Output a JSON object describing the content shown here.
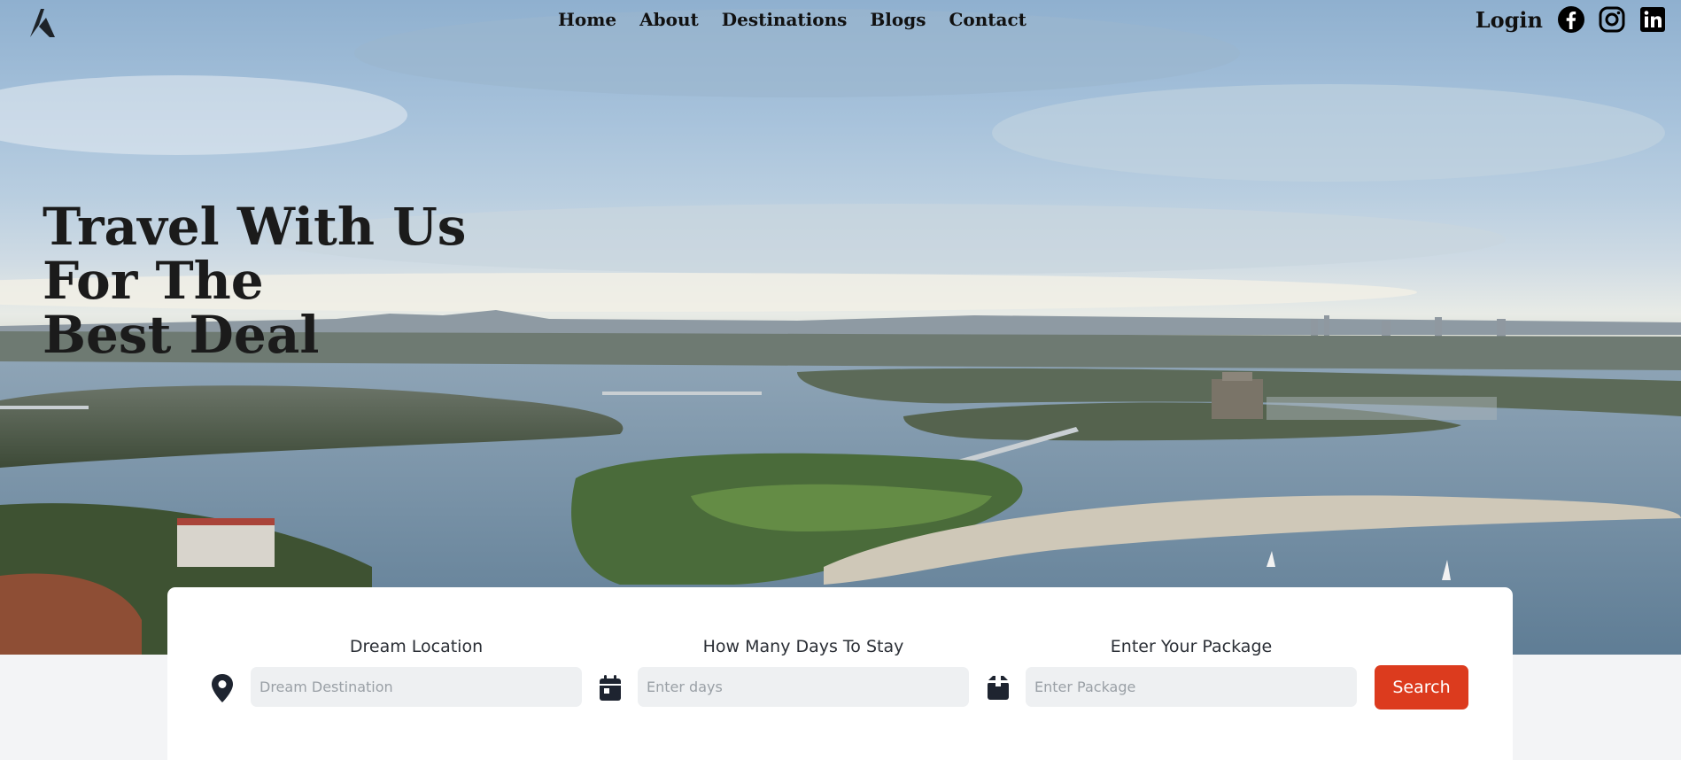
{
  "nav": {
    "links": [
      "Home",
      "About",
      "Destinations",
      "Blogs",
      "Contact"
    ],
    "login": "Login"
  },
  "icons": {
    "logo": "a-logo-icon",
    "facebook": "facebook-icon",
    "instagram": "instagram-icon",
    "linkedin": "linkedin-icon",
    "location": "map-pin-icon",
    "days": "calendar-icon",
    "package": "box-icon"
  },
  "hero": {
    "headline": [
      "Travel With Us",
      "For The",
      "Best Deal"
    ]
  },
  "search": {
    "location": {
      "label": "Dream Location",
      "placeholder": "Dream Destination",
      "value": ""
    },
    "days": {
      "label": "How Many Days To Stay",
      "placeholder": "Enter days",
      "value": ""
    },
    "package": {
      "label": "Enter Your Package",
      "placeholder": "Enter Package",
      "value": ""
    },
    "button": "Search"
  },
  "colors": {
    "accent": "#dc3b1e",
    "text": "#111111",
    "input_bg": "#eef0f2"
  }
}
